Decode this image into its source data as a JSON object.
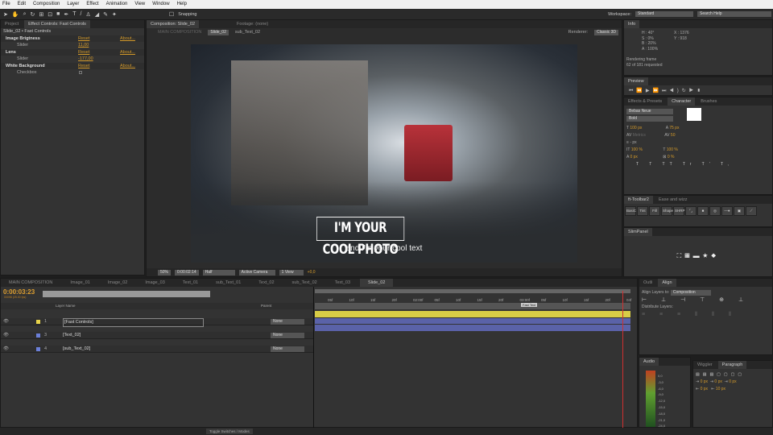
{
  "menu": [
    "File",
    "Edit",
    "Composition",
    "Layer",
    "Effect",
    "Animation",
    "View",
    "Window",
    "Help"
  ],
  "toolbar": {
    "snapping": "Snapping",
    "workspace_label": "Workspace:",
    "workspace": "Standard",
    "search_placeholder": "Search Help"
  },
  "left_panel": {
    "tabs": [
      "Project",
      "Effect Controls: Fast Controls"
    ],
    "breadcrumb": "Slide_02 • Fast Controls",
    "effects": [
      {
        "name": "Image Brigtness",
        "reset": "Reset",
        "about": "About...",
        "prop": "Slider",
        "value": "11,00"
      },
      {
        "name": "Lens",
        "reset": "Reset",
        "about": "About...",
        "prop": "Slider",
        "value": "-177,00"
      },
      {
        "name": "White Background",
        "reset": "Reset",
        "about": "About...",
        "prop": "Checkbox",
        "value": ""
      }
    ]
  },
  "comp": {
    "tab": "Composition: Slide_02",
    "footage_tab": "Footage: (none)",
    "crumbs": [
      "MAIN COMPOSITION",
      "Slide_02",
      "sub_Text_02"
    ],
    "renderer_label": "Renderer:",
    "renderer": "Classic 3D",
    "title_text": "I'M YOUR COOL PHOTO",
    "sub_text": "and I'm your cool text",
    "zoom": "50%",
    "timecode": "0:00:02:14",
    "resolution": "Half",
    "camera": "Active Camera",
    "view": "1 View",
    "exposure": "+0,0"
  },
  "info": {
    "tab": "Info",
    "h": "H : 40°",
    "s": "S : 0%",
    "b": "B : 20%",
    "a": "A : 100%",
    "x": "X : 1376",
    "y": "Y : 918",
    "status1": "Rendering frame",
    "status2": "62 of 181 requested"
  },
  "preview": {
    "tab": "Preview"
  },
  "character": {
    "tabs": [
      "Effects & Presets",
      "Character",
      "Brushes"
    ],
    "font": "Bebas Neue",
    "style": "Bold",
    "size": "100 px",
    "leading": "75 px",
    "kerning": "Metrics",
    "tracking": "50",
    "stroke": "- px",
    "vscale": "100 %",
    "hscale": "100 %",
    "baseline": "0 px",
    "tsume": "0 %"
  },
  "ft_toolbar": {
    "tabs": [
      "ft-Toolbar2",
      "Ease and wizz"
    ],
    "buttons": [
      "BasiC",
      "Tint",
      "Fill",
      "Shape",
      "SHRP"
    ]
  },
  "slim": {
    "tab": "SlimPanel"
  },
  "timeline": {
    "tabs": [
      "MAIN COMPOSITION",
      "Image_01",
      "Image_02",
      "Image_03",
      "Text_01",
      "sub_Text_01",
      "Text_02",
      "sub_Text_02",
      "Text_03",
      "Slide_02"
    ],
    "timecode": "0:00:03:23",
    "fps": "00098 (25.00 fps)",
    "col_layer": "Layer Name",
    "col_parent": "Parent",
    "layers": [
      {
        "num": "1",
        "name": "[Fast Controls]",
        "color": "#e8d44a",
        "parent": "None",
        "bar": "#d8cc46"
      },
      {
        "num": "3",
        "name": "[Text_02]",
        "color": "#6b7fd8",
        "parent": "None",
        "bar": "#5a62a8"
      },
      {
        "num": "4",
        "name": "[sub_Text_02]",
        "color": "#6b7fd8",
        "parent": "None",
        "bar": "#5a62a8"
      }
    ],
    "ruler": [
      "05f",
      "10f",
      "15f",
      "20f",
      "02:00f",
      "05f",
      "10f",
      "15f",
      "20f",
      "03:00f",
      "05f",
      "10f",
      "15f",
      "20f",
      "04f"
    ],
    "marker": "Fast Text",
    "toggle": "Toggle Switches / Modes"
  },
  "align": {
    "tabs": [
      "Outli",
      "Align"
    ],
    "align_to_label": "Align Layers to:",
    "align_to": "Composition",
    "distribute": "Distribute Layers:"
  },
  "audio": {
    "tab": "Audio",
    "levels": [
      "0,0",
      "-3,0",
      "-6,0",
      "-9,0",
      "-12,0",
      "-15,0",
      "-18,0",
      "-21,0",
      "-24,0"
    ]
  },
  "paragraph": {
    "tabs": [
      "Wiggler",
      "Paragraph"
    ],
    "indent_left": "0 px",
    "indent_first": "0 px",
    "indent_right": "0 px",
    "space_before": "0 px",
    "space_after": "10 px"
  }
}
